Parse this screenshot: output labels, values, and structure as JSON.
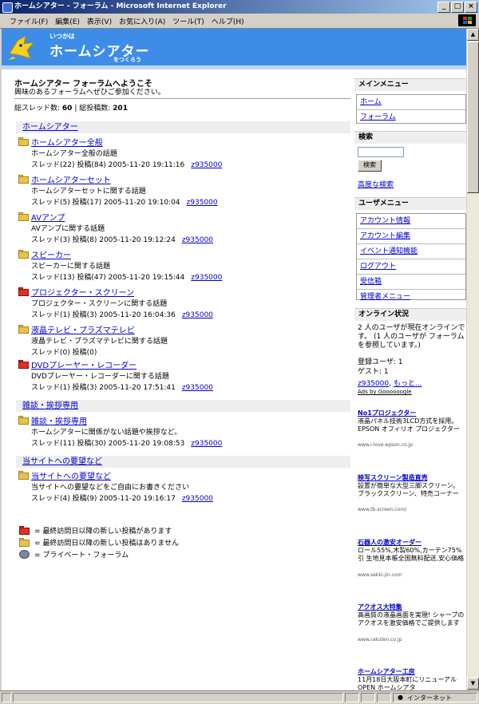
{
  "window": {
    "title": "ホームシアター - フォーラム - Microsoft Internet Explorer"
  },
  "menu": [
    "ファイル(F)",
    "編集(E)",
    "表示(V)",
    "お気に入り(A)",
    "ツール(T)",
    "ヘルプ(H)"
  ],
  "banner": {
    "small_top": "いつかは",
    "title": "ホームシアター",
    "small_bottom": "をつくろう"
  },
  "welcome": {
    "title": "ホームシアター フォーラムへようこそ",
    "subtitle": "興味のあるフォーラムへぜひご参加ください。"
  },
  "stats": {
    "threads_label": "総スレッド数:",
    "threads": "60",
    "sep": "|",
    "posts_label": "総投稿数:",
    "posts": "201"
  },
  "categories": [
    {
      "name": "ホームシアター",
      "forums": [
        {
          "title": "ホームシアター全般",
          "desc": "ホームシアター全般の話題",
          "meta": "スレッド(22) 投稿(84) 2005-11-20 19:11:16",
          "user": "z935000",
          "icon": "yellow"
        },
        {
          "title": "ホームシアターセット",
          "desc": "ホームシアターセットに関する話題",
          "meta": "スレッド(5) 投稿(17) 2005-11-20 19:10:04",
          "user": "z935000",
          "icon": "yellow"
        },
        {
          "title": "AVアンプ",
          "desc": "AVアンプに関する話題",
          "meta": "スレッド(3) 投稿(8) 2005-11-20 19:12:24",
          "user": "z935000",
          "icon": "yellow"
        },
        {
          "title": "スピーカー",
          "desc": "スピーカーに関する話題",
          "meta": "スレッド(13) 投稿(47) 2005-11-20 19:15:44",
          "user": "z935000",
          "icon": "yellow"
        },
        {
          "title": "プロジェクター・スクリーン",
          "desc": "プロジェクター・スクリーンに関する話題",
          "meta": "スレッド(1) 投稿(3) 2005-11-20 16:04:36",
          "user": "z935000",
          "icon": "red"
        },
        {
          "title": "液晶テレビ・プラズマテレビ",
          "desc": "液晶テレビ・プラズマテレビに関する話題",
          "meta": "スレッド(0) 投稿(0)",
          "user": "",
          "icon": "yellow"
        },
        {
          "title": "DVDプレーヤー・レコーダー",
          "desc": "DVDプレーヤー・レコーダーに関する話題",
          "meta": "スレッド(1) 投稿(3) 2005-11-20 17:51:41",
          "user": "z935000",
          "icon": "red"
        }
      ]
    },
    {
      "name": "雑談・挨拶専用",
      "forums": [
        {
          "title": "雑談・挨拶専用",
          "desc": "ホームシアターに関係がない話題や挨拶など。",
          "meta": "スレッド(11) 投稿(30) 2005-11-20 19:08:53",
          "user": "z935000",
          "icon": "yellow"
        }
      ]
    },
    {
      "name": "当サイトへの要望など",
      "forums": [
        {
          "title": "当サイトへの要望など",
          "desc": "当サイトへの要望などをご自由にお書きください",
          "meta": "スレッド(4) 投稿(9) 2005-11-20 19:16:17",
          "user": "z935000",
          "icon": "yellow"
        }
      ]
    }
  ],
  "legend": {
    "new": "= 最終訪問日以降の新しい投稿があります",
    "none": "= 最終訪問日以降の新しい投稿はありません",
    "private": "= プライベート・フォーラム"
  },
  "sidebar": {
    "main_menu_title": "メインメニュー",
    "main_menu": [
      "ホーム",
      "フォーラム"
    ],
    "search_title": "検索",
    "search_button": "検索",
    "advanced_search": "高度な検索",
    "user_menu_title": "ユーザメニュー",
    "user_menu": [
      "アカウント情報",
      "アカウント編集",
      "イベント通知機能",
      "ログアウト",
      "受信箱",
      "管理者メニュー"
    ],
    "online_title": "オンライン状況",
    "online_line1": "2 人のユーザが現在オンラインです。 (1 人のユーザが フォーラム を参照しています。)",
    "online_registered": "登録ユーザ: 1",
    "online_guests": "ゲスト: 1",
    "online_user": "z935000",
    "online_more": "もっと...",
    "ads_by": "Ads by Goooooogle",
    "ads": [
      {
        "title": "No1プロジェクター",
        "body": "液晶パネル技術3LCD方式を採用。EPSON オフィリオ プロジェクター",
        "url": "www.i-love-epson.co.jp"
      },
      {
        "title": "映写スクリーン製造直売",
        "body": "設置が簡単な大型三脚スクリーン。ブラックスクリーン、特売コーナー",
        "url": "www.tb-screen.com/"
      },
      {
        "title": "石器人の激安オーダー",
        "body": "ロール55%,木製60%,カーテン75%引 生地見本帳全国無料配送,安心価格",
        "url": "www.sekki-jin.com"
      },
      {
        "title": "アクオス大特集",
        "body": "高画質の液晶画面を実現! シャープの アクオスを激安価格でご提供します",
        "url": "www.rakuten.co.jp"
      },
      {
        "title": "ホームシアター工房",
        "body": "11月18日大阪本町にリニューアルOPEN ホームシアタ",
        "url": ""
      }
    ]
  },
  "statusbar": {
    "zone": "インターネット"
  }
}
